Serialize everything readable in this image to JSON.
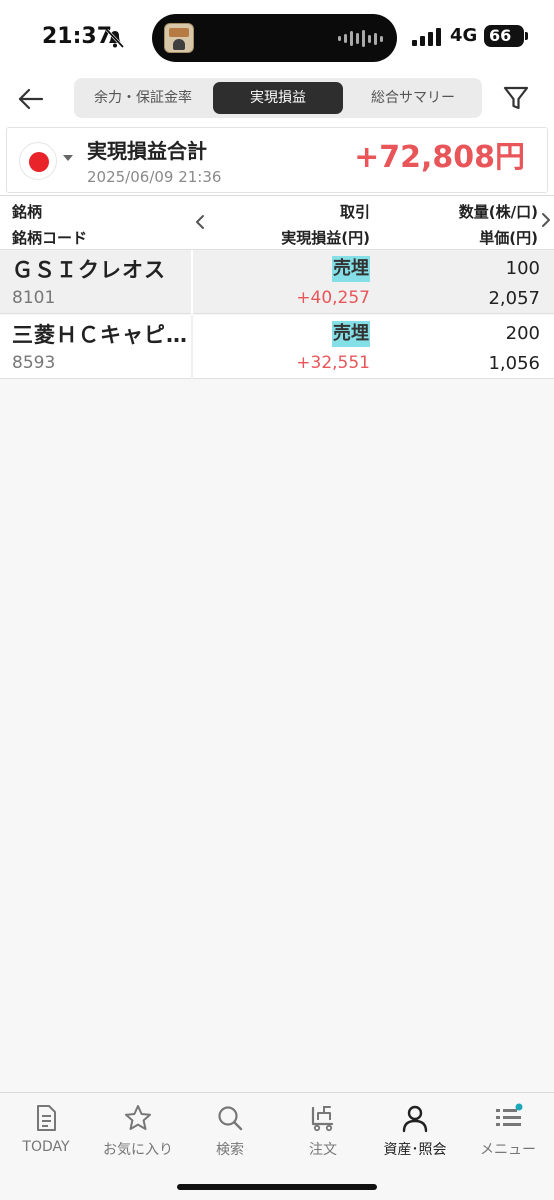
{
  "status_bar": {
    "time": "21:37",
    "network": "4G",
    "battery": "66",
    "icons": [
      "bell-off-icon",
      "signal-icon",
      "battery-icon"
    ]
  },
  "header": {
    "segments": [
      {
        "label": "余力・保証金率",
        "active": false
      },
      {
        "label": "実現損益",
        "active": true
      },
      {
        "label": "総合サマリー",
        "active": false
      }
    ],
    "icons": [
      "back-arrow-icon",
      "filter-icon"
    ]
  },
  "summary": {
    "title": "実現損益合計",
    "date": "2025/06/09 21:36",
    "total": "+72,808円",
    "market_icon": "japan-flag-icon"
  },
  "table": {
    "headers": {
      "name": "銘柄",
      "code": "銘柄コード",
      "trade": "取引",
      "pnl": "実現損益(円)",
      "qty": "数量(株/口)",
      "price": "単価(円)"
    },
    "rows": [
      {
        "name": "ＧＳＩクレオス",
        "code": "8101",
        "trade": "売埋",
        "pnl": "+40,257",
        "qty": "100",
        "price": "2,057"
      },
      {
        "name": "三菱ＨＣキャピ…",
        "code": "8593",
        "trade": "売埋",
        "pnl": "+32,551",
        "qty": "200",
        "price": "1,056"
      }
    ]
  },
  "tabbar": {
    "items": [
      {
        "label": "TODAY",
        "icon": "document-icon"
      },
      {
        "label": "お気に入り",
        "icon": "star-icon"
      },
      {
        "label": "検索",
        "icon": "search-icon"
      },
      {
        "label": "注文",
        "icon": "cart-icon"
      },
      {
        "label": "資産･照会",
        "icon": "person-icon",
        "active": true
      },
      {
        "label": "メニュー",
        "icon": "menu-icon",
        "badge": true
      }
    ]
  },
  "colors": {
    "profit": "#e8565a",
    "trade_badge": "#84dfe6",
    "active_segment": "#2e2e2e",
    "notification_dot": "#1ba8b9"
  }
}
